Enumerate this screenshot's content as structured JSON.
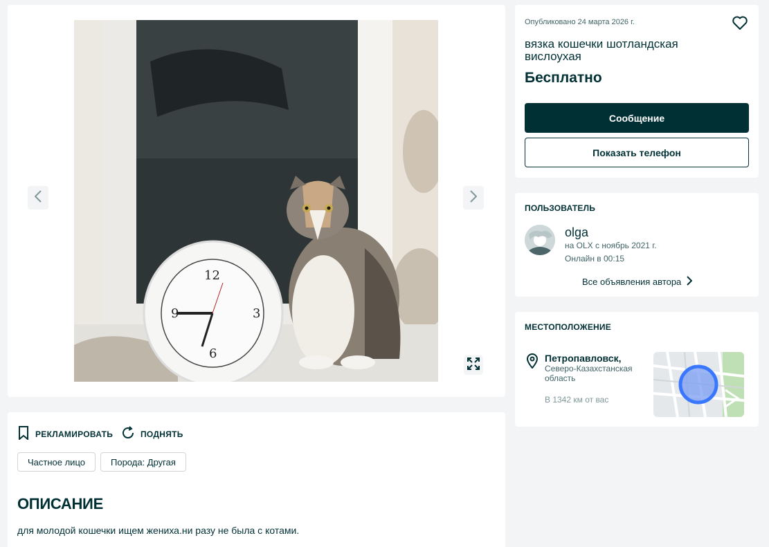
{
  "gallery": {
    "photo_alt": "Шотландская вислоухая кошка сидит на подоконнике рядом с часами",
    "prev_icon": "chevron-left-icon",
    "next_icon": "chevron-right-icon",
    "expand_icon": "expand-icon"
  },
  "actions": {
    "promote_label": "РЕКЛАМИРОВАТЬ",
    "raise_label": "ПОДНЯТЬ"
  },
  "tags": [
    "Частное лицо",
    "Порода: Другая"
  ],
  "description": {
    "title": "ОПИСАНИЕ",
    "text": "для молодой кошечки ищем жениха.ни разу не была с котами."
  },
  "ad": {
    "published": "Опубликовано 24 марта 2026 г.",
    "title": "вязка кошечки шотландская вислоухая",
    "price": "Бесплатно",
    "message_button": "Сообщение",
    "phone_button": "Показать телефон"
  },
  "user": {
    "section_title": "ПОЛЬЗОВАТЕЛЬ",
    "name": "olga",
    "since": "на OLX с ноябрь 2021 г.",
    "online": "Онлайн в 00:15",
    "all_ads": "Все объявления автора"
  },
  "location": {
    "section_title": "МЕСТОПОЛОЖЕНИЕ",
    "city": "Петропавловск,",
    "region": "Северо-Казахстанская область",
    "distance": "В 1342 км от вас"
  },
  "colors": {
    "primary": "#002f34",
    "background": "#f2f4f5",
    "map_marker": "#3a77ff"
  }
}
